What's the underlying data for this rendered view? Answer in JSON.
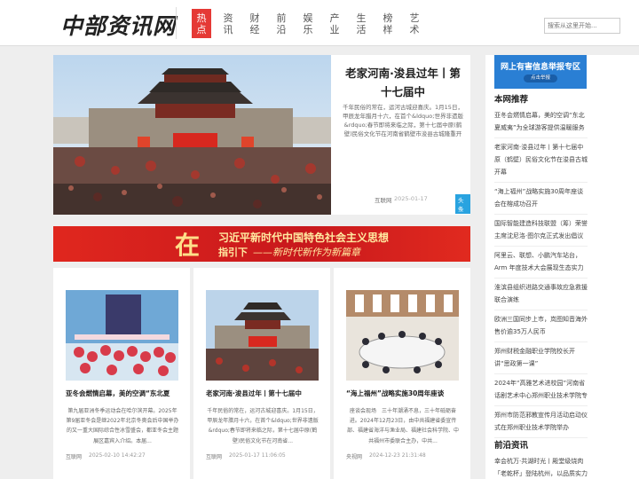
{
  "header": {
    "logo": "中部资讯网",
    "nav": [
      "热点",
      "资讯",
      "财经",
      "前沿",
      "娱乐",
      "产业",
      "生活",
      "榜样",
      "艺术"
    ],
    "search_placeholder": "搜索从这里开始..."
  },
  "feature": {
    "title": "老家河南·浚县过年丨第十七届中",
    "desc": "千年民俗的常在，运河古城迎喜庆。1月15日，甲辰龙年腊月十六，在首个&ldquo;世界非遗版&rdquo;春节即将来临之际，第十七届中原(鹤壁)民俗文化节在河南省鹤壁市浚县古城隆重开",
    "source": "互联网",
    "date": "2025-01-17",
    "tag": "头条"
  },
  "banner": {
    "char": "在",
    "line1": "习近平新时代中国特色社会主义思想",
    "line2": "指引下",
    "line2_tail": "——新时代新作为新篇章"
  },
  "cards": [
    {
      "title": "亚冬会燃情启幕，美的空调“东北夏",
      "desc": "第九届亚洲冬季运动会在哈尔滨开幕。2025年第9届亚冬会是继2022年北京冬奥会后中国举办的又一重大国际综合性冰雪盛会，都亚冬会主题展区嘉宾入介绍。本届...",
      "source": "互联网",
      "date": "2025-02-10 14:42:27"
    },
    {
      "title": "老家河南·浚县过年丨第十七届中",
      "desc": "千年民俗的常在，运河古城迎喜庆。1月15日，甲辰龙年腊月十六，在首个&ldquo;世界非遗版&rdquo;春节即将来临之际，第十七届中原(鹤壁)民俗文化节在河南省...",
      "source": "互联网",
      "date": "2025-01-17 11:06:05"
    },
    {
      "title": "“海上福州”战略实施30周年座谈",
      "desc": "座谈会现场　三十年潮涌不息，三十年砥砺奋进。2024年12月23日，由中共福建省委宣传部、福建省海洋与渔业局、福建社会科学院、中共福州市委联合主办，中共...",
      "source": "央视网",
      "date": "2024-12-23 21:31:48"
    }
  ],
  "sidebar": {
    "report_title": "网上有害信息举报专区",
    "report_button": "点击举报",
    "section1": "本网推荐",
    "recommend": [
      "亚冬会燃情启幕，美的空调“东北夏威夷”为全球游客提供温暖服务",
      "老家河南·浚县过年丨第十七届中原（鹤壁）民俗文化节在浚县古城开幕",
      "“海上福州”战略实施30周年座谈会在榕成功召开",
      "国际智能建造科技联盟（筹）荣誉主席沈尼洛·图尔克正式发出倡议",
      "阿里云、联想、小鹏汽车站台，Arm 年度技术大会展现生态实力",
      "淮滨县组织进路交通事故应急救援联合演练",
      "欧洲三国同步上市，岚图知音海外售价逾35万人民币",
      "郑州财税金融职业学院校长开讲“思政第一课”",
      "2024年“高雅艺术进校园”河南省话剧艺术中心郑州职业技术学院专",
      "郑州市防范邪教宣传月活动启动仪式在郑州职业技术学院举办"
    ],
    "section2": "前沿资讯",
    "frontier": [
      "幸会杭万·共湖时光丨殿堂级烧肉「老乾杯」登陆杭州，以品质实力"
    ]
  }
}
